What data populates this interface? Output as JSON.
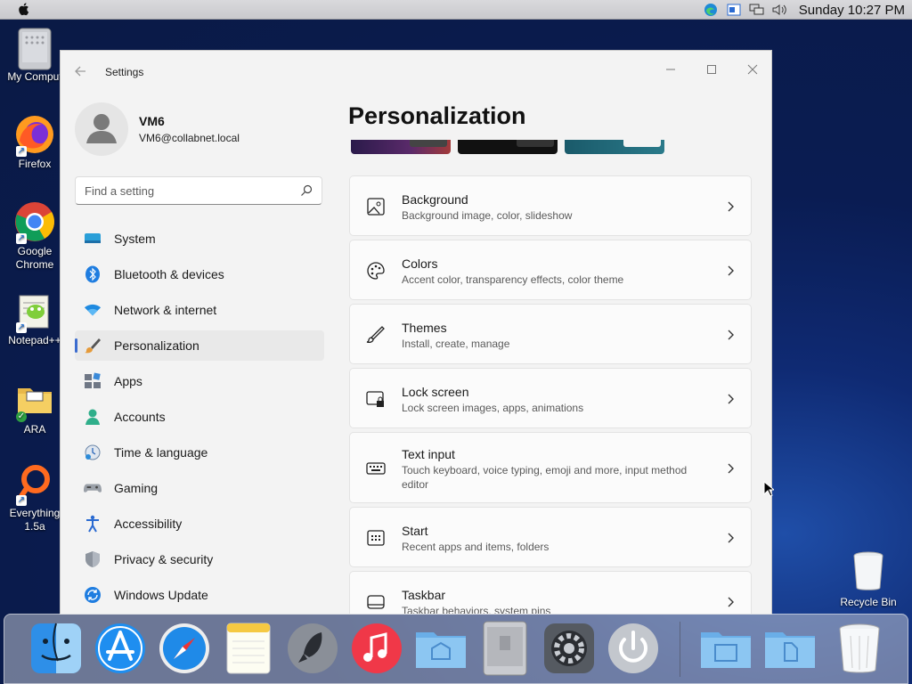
{
  "menubar": {
    "clock": "Sunday 10:27 PM"
  },
  "desktop_icons": [
    {
      "label": "My Comput",
      "icon": "mac-pro-icon"
    },
    {
      "label": "Firefox",
      "icon": "firefox-icon"
    },
    {
      "label": "Google Chrome",
      "icon": "chrome-icon"
    },
    {
      "label": "Notepad++",
      "icon": "notepadpp-icon"
    },
    {
      "label": "ARA",
      "icon": "folder-icon"
    },
    {
      "label": "Everything 1.5a",
      "icon": "everything-icon"
    }
  ],
  "recycle_bin": {
    "label": "Recycle Bin"
  },
  "window": {
    "title": "Settings",
    "user": {
      "name": "VM6",
      "email": "VM6@collabnet.local"
    },
    "search": {
      "placeholder": "Find a setting"
    },
    "nav": [
      {
        "label": "System",
        "icon": "system-icon",
        "active": false
      },
      {
        "label": "Bluetooth & devices",
        "icon": "bluetooth-icon",
        "active": false
      },
      {
        "label": "Network & internet",
        "icon": "wifi-icon",
        "active": false
      },
      {
        "label": "Personalization",
        "icon": "brush-icon",
        "active": true
      },
      {
        "label": "Apps",
        "icon": "apps-icon",
        "active": false
      },
      {
        "label": "Accounts",
        "icon": "accounts-icon",
        "active": false
      },
      {
        "label": "Time & language",
        "icon": "time-language-icon",
        "active": false
      },
      {
        "label": "Gaming",
        "icon": "gamepad-icon",
        "active": false
      },
      {
        "label": "Accessibility",
        "icon": "accessibility-icon",
        "active": false
      },
      {
        "label": "Privacy & security",
        "icon": "shield-icon",
        "active": false
      },
      {
        "label": "Windows Update",
        "icon": "update-icon",
        "active": false
      }
    ],
    "page_title": "Personalization",
    "cards": [
      {
        "title": "Background",
        "subtitle": "Background image, color, slideshow",
        "icon": "image-icon"
      },
      {
        "title": "Colors",
        "subtitle": "Accent color, transparency effects, color theme",
        "icon": "palette-icon"
      },
      {
        "title": "Themes",
        "subtitle": "Install, create, manage",
        "icon": "pen-icon"
      },
      {
        "title": "Lock screen",
        "subtitle": "Lock screen images, apps, animations",
        "icon": "lock-screen-icon"
      },
      {
        "title": "Text input",
        "subtitle": "Touch keyboard, voice typing, emoji and more, input method editor",
        "icon": "keyboard-icon"
      },
      {
        "title": "Start",
        "subtitle": "Recent apps and items, folders",
        "icon": "start-icon"
      },
      {
        "title": "Taskbar",
        "subtitle": "Taskbar behaviors, system pins",
        "icon": "taskbar-icon"
      }
    ]
  },
  "dock": [
    {
      "name": "finder-icon"
    },
    {
      "name": "app-store-icon"
    },
    {
      "name": "safari-icon"
    },
    {
      "name": "notes-icon"
    },
    {
      "name": "launchpad-icon"
    },
    {
      "name": "music-icon"
    },
    {
      "name": "applications-folder-icon"
    },
    {
      "name": "mac-pro-icon"
    },
    {
      "name": "system-preferences-icon"
    },
    {
      "name": "power-icon"
    },
    {
      "name": "documents-folder-icon"
    },
    {
      "name": "downloads-folder-icon"
    },
    {
      "name": "trash-icon"
    }
  ],
  "colors": {
    "accent": "#3b6ccf"
  }
}
